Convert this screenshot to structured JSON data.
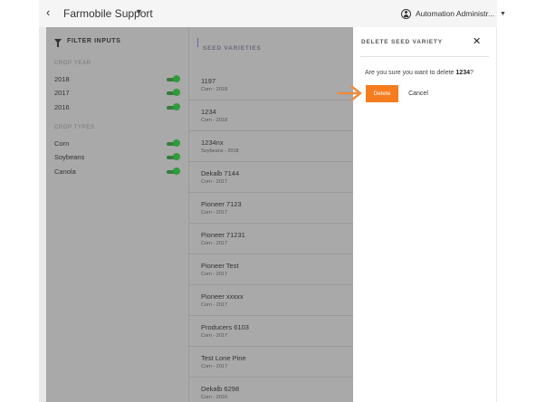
{
  "topbar": {
    "org_name": "Farmobile Support",
    "user_name": "Automation Administr..."
  },
  "filters": {
    "title": "FILTER INPUTS",
    "crop_year_label": "CROP YEAR",
    "years": [
      {
        "label": "2018",
        "on": true
      },
      {
        "label": "2017",
        "on": true
      },
      {
        "label": "2016",
        "on": true
      }
    ],
    "crop_types_label": "CROP TYPES",
    "crops": [
      {
        "label": "Corn",
        "on": true
      },
      {
        "label": "Soybeans",
        "on": true
      },
      {
        "label": "Canola",
        "on": true
      }
    ]
  },
  "seeds": {
    "title": "SEED VARIETIES",
    "items": [
      {
        "name": "1197",
        "sub": "Corn - 2018"
      },
      {
        "name": "1234",
        "sub": "Corn - 2018"
      },
      {
        "name": "1234nx",
        "sub": "Soybeans - 2018"
      },
      {
        "name": "Dekalb 7144",
        "sub": "Corn - 2017"
      },
      {
        "name": "Pioneer 7123",
        "sub": "Corn - 2017"
      },
      {
        "name": "Pioneer 71231",
        "sub": "Corn - 2017"
      },
      {
        "name": "Pioneer Test",
        "sub": "Corn - 2017"
      },
      {
        "name": "Pioneer xxxxx",
        "sub": "Corn - 2017"
      },
      {
        "name": "Producers 6103",
        "sub": "Corn - 2017"
      },
      {
        "name": "Test Lone Pine",
        "sub": "Corn - 2017"
      },
      {
        "name": "Dekalb 6298",
        "sub": "Corn - 2016"
      }
    ]
  },
  "dialog": {
    "title": "DELETE SEED VARIETY",
    "message_prefix": "Are you sure you want to delete ",
    "message_target": "1234",
    "message_suffix": "?",
    "delete_label": "Delete",
    "cancel_label": "Cancel"
  },
  "colors": {
    "accent": "#f57c1f",
    "toggle_on": "#2e9c3a",
    "overlay": "#a9a9a9"
  }
}
